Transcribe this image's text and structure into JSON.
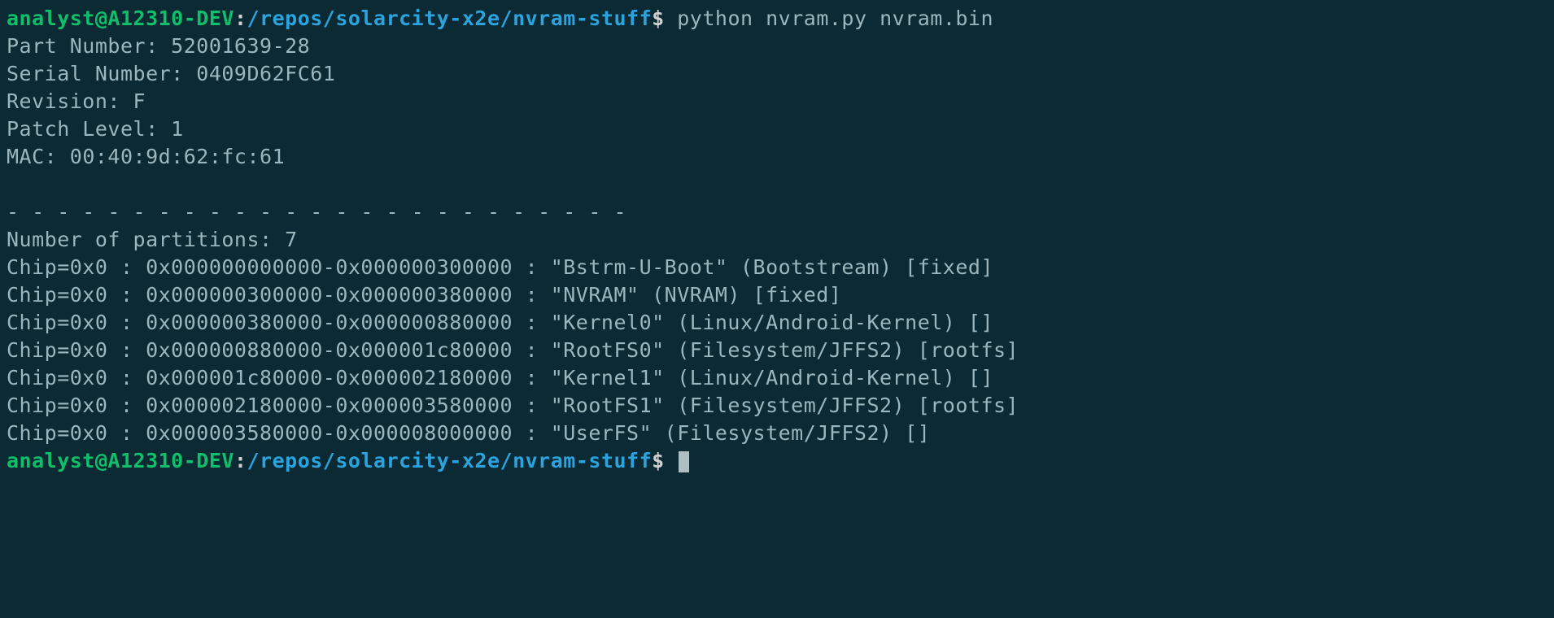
{
  "prompt": {
    "user_host": "analyst@A12310-DEV",
    "colon": ":",
    "path": "/repos/solarcity-x2e/nvram-stuff",
    "dollar": "$ "
  },
  "command": "python nvram.py nvram.bin",
  "output": {
    "part_number_label": "Part Number: ",
    "part_number": "52001639-28",
    "serial_number_label": "Serial Number: ",
    "serial_number": "0409D62FC61",
    "revision_label": "Revision: ",
    "revision": "F",
    "patch_level_label": "Patch Level: ",
    "patch_level": "1",
    "mac_label": "MAC: ",
    "mac": "00:40:9d:62:fc:61",
    "blank": "",
    "divider": "- - - - - - - - - - - - - - - - - - - - - - - - -",
    "num_partitions_label": "Number of partitions: ",
    "num_partitions": "7",
    "partitions": [
      "Chip=0x0 : 0x000000000000-0x000000300000 : \"Bstrm-U-Boot\" (Bootstream) [fixed]",
      "Chip=0x0 : 0x000000300000-0x000000380000 : \"NVRAM\" (NVRAM) [fixed]",
      "Chip=0x0 : 0x000000380000-0x000000880000 : \"Kernel0\" (Linux/Android-Kernel) []",
      "Chip=0x0 : 0x000000880000-0x000001c80000 : \"RootFS0\" (Filesystem/JFFS2) [rootfs]",
      "Chip=0x0 : 0x000001c80000-0x000002180000 : \"Kernel1\" (Linux/Android-Kernel) []",
      "Chip=0x0 : 0x000002180000-0x000003580000 : \"RootFS1\" (Filesystem/JFFS2) [rootfs]",
      "Chip=0x0 : 0x000003580000-0x000008000000 : \"UserFS\" (Filesystem/JFFS2) []"
    ]
  }
}
